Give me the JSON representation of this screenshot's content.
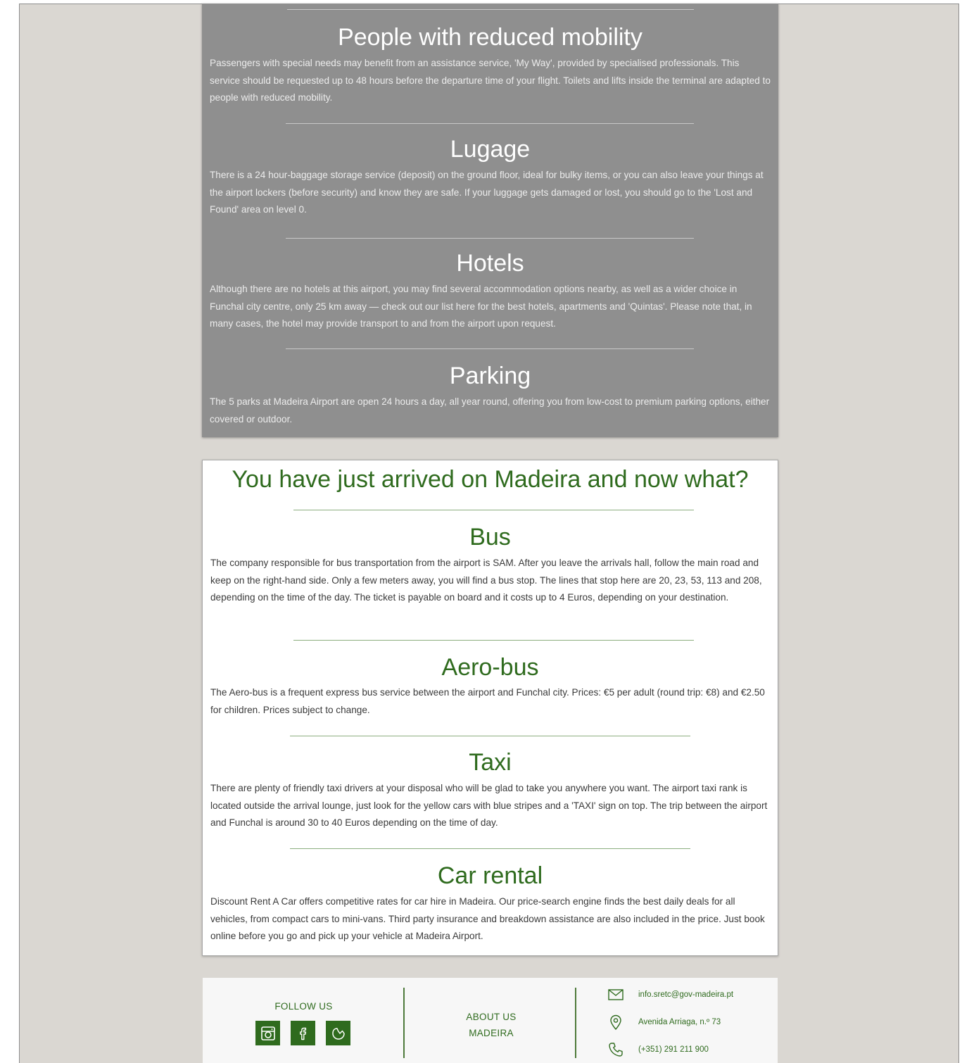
{
  "airport_info": [
    {
      "title": "People with reduced mobility",
      "body": "Passengers with special needs may benefit from an assistance service, 'My Way', provided by specialised professionals. This service should be requested up to 48 hours before the departure time of your flight. Toilets and lifts inside the terminal are adapted to people with reduced mobility."
    },
    {
      "title": "Lugage",
      "body": "There is a 24 hour-baggage storage service (deposit) on the ground floor, ideal for bulky items, or you can also leave your things at the airport lockers (before security) and know they are safe. If your luggage gets damaged or lost, you should go to the 'Lost and Found' area on level 0."
    },
    {
      "title": "Hotels",
      "body": "Although there are no hotels at this airport, you may find several accommodation options nearby, as well as a wider choice in Funchal city centre, only 25 km away — check out our list here for the best hotels, apartments and 'Quintas'. Please note that, in many cases, the hotel may provide transport to and from the airport upon request."
    },
    {
      "title": "Parking",
      "body": "The 5 parks at Madeira Airport are open 24 hours a day, all year round, offering you from low-cost to premium parking options, either covered or outdoor."
    }
  ],
  "arrival": {
    "title": "You have just arrived on Madeira and now what?",
    "sections": [
      {
        "title": "Bus",
        "body": "The company responsible for bus transportation from the airport is SAM. After you leave the arrivals hall, follow the main road and keep on the right-hand side. Only a few meters away, you will find a bus stop. The lines that stop here are 20, 23, 53, 113 and 208, depending on the time of the day. The ticket is payable on board and it costs up to 4 Euros, depending on your destination."
      },
      {
        "title": "Aero-bus",
        "body": "The Aero-bus is a frequent express bus service between the airport and Funchal city. Prices: €5 per adult (round trip: €8) and €2.50 for children. Prices subject to change."
      },
      {
        "title": "Taxi",
        "body": "There are plenty of friendly taxi drivers at your disposal who will be glad to take you anywhere you want. The airport taxi rank is located outside the arrival lounge, just look for the yellow cars with blue stripes and a 'TAXI' sign on top. The trip between the airport and Funchal is around 30 to 40 Euros depending on the time of day."
      },
      {
        "title": "Car rental",
        "body": "Discount Rent A Car offers competitive rates for car hire in Madeira. Our price-search engine finds the best daily deals for all vehicles, from compact cars to mini-vans. Third party insurance and breakdown assistance are also included in the price. Just book online before you go and pick up your vehicle at Madeira Airport."
      }
    ]
  },
  "footer": {
    "follow_label": "FOLLOW US",
    "social_icons": [
      "instagram-icon",
      "facebook-icon",
      "tripadvisor-icon"
    ],
    "about_line1": "ABOUT US",
    "about_line2": "MADEIRA",
    "email": "info.sretc@gov-madeira.pt",
    "address": "Avenida Arriaga, n.º 73",
    "phone": "(+351) 291 211 900"
  },
  "colors": {
    "background": "#dad7d2",
    "gray_card": "#8f8f8f",
    "accent_green": "#2f6b1e"
  }
}
